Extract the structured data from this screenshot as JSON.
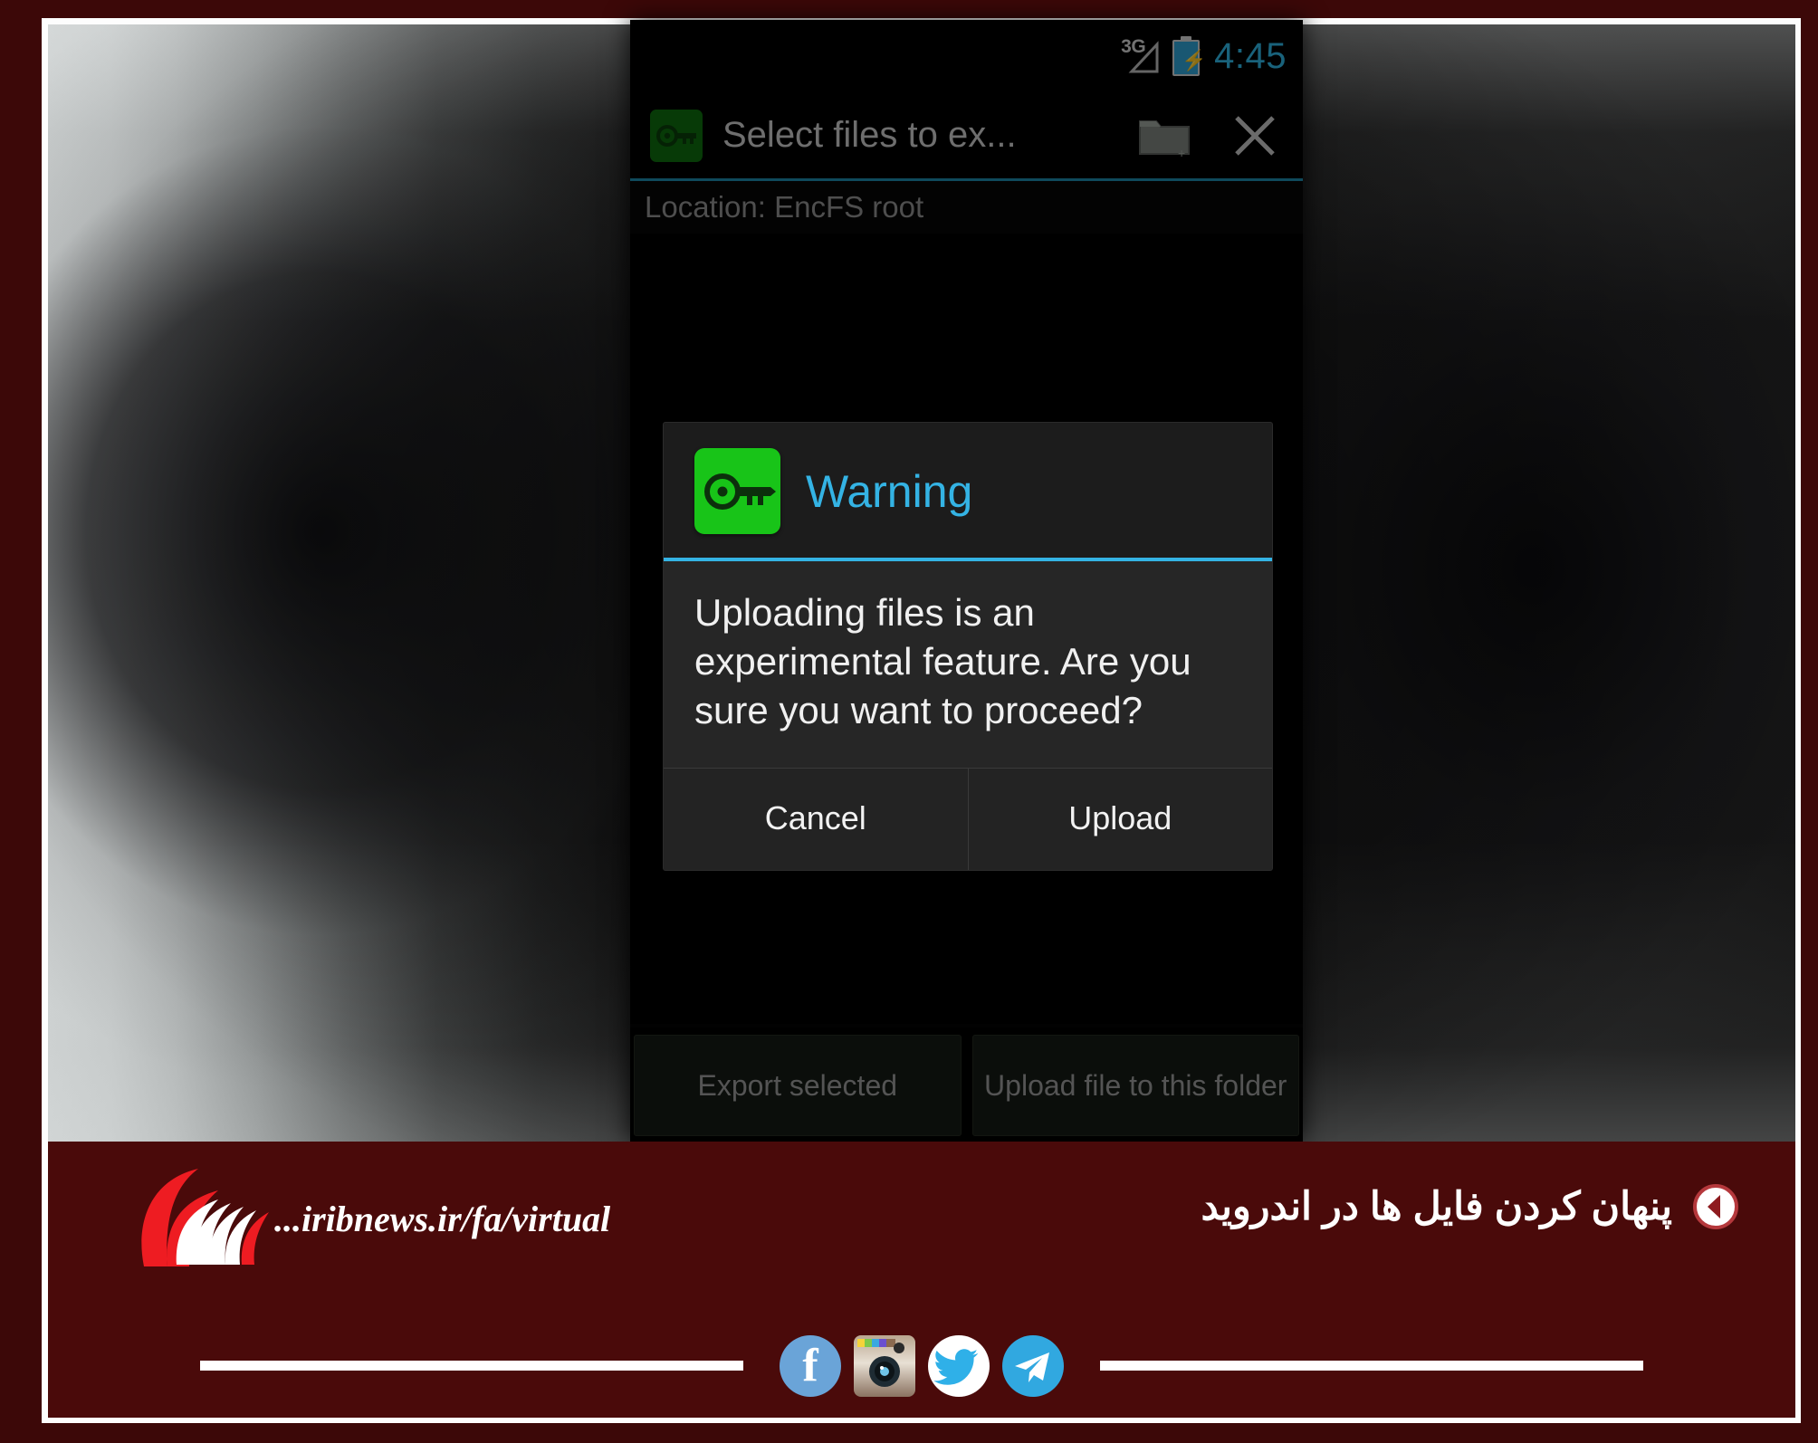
{
  "status_bar": {
    "network_label": "3G",
    "time": "4:45",
    "battery_state": "charging",
    "time_color": "#2fb3e0"
  },
  "action_bar": {
    "app_icon": "green-key-icon",
    "title": "Select files to ex...",
    "new_folder_icon": "folder-add-icon",
    "close_icon": "close-x-icon",
    "accent_color": "#1d88a8"
  },
  "location": {
    "text": "Location: EncFS root"
  },
  "dialog": {
    "icon": "green-key-icon",
    "title": "Warning",
    "title_color": "#34b3e4",
    "message": "Uploading files is an experimental feature. Are you sure you want to proceed?",
    "buttons": [
      {
        "label": "Cancel",
        "name": "cancel-button"
      },
      {
        "label": "Upload",
        "name": "upload-button"
      }
    ]
  },
  "bottom_bar": {
    "buttons": [
      {
        "label": "Export selected",
        "name": "export-selected-button"
      },
      {
        "label": "Upload file to this folder",
        "name": "upload-to-folder-button"
      }
    ]
  },
  "banner": {
    "background_color": "#4a0a0a",
    "logo_name": "irib-logo",
    "site_url": "...iribnews.ir/fa/virtual",
    "headline": "پنهان کردن فایل ها در اندروید",
    "back_arrow_icon": "back-arrow-circle-icon",
    "social": [
      {
        "name": "facebook-icon",
        "label": "f"
      },
      {
        "name": "instagram-icon",
        "label": ""
      },
      {
        "name": "twitter-icon",
        "label": ""
      },
      {
        "name": "telegram-icon",
        "label": ""
      }
    ]
  }
}
